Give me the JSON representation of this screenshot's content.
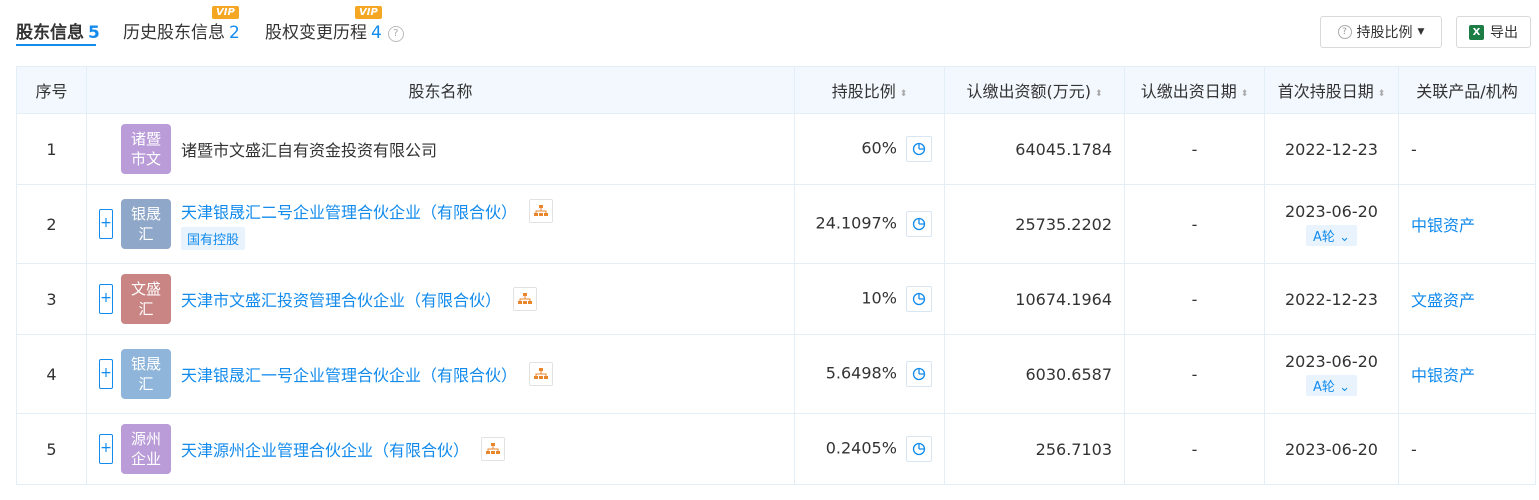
{
  "tabs": [
    {
      "label": "股东信息",
      "count": "5",
      "active": true
    },
    {
      "label": "历史股东信息",
      "count": "2",
      "vip": "VIP"
    },
    {
      "label": "股权变更历程",
      "count": "4",
      "vip": "VIP"
    }
  ],
  "toolbar": {
    "ratio_label": "持股比例",
    "export_label": "导出"
  },
  "columns": [
    "序号",
    "股东名称",
    "持股比例",
    "认缴出资额(万元)",
    "认缴出资日期",
    "首次持股日期",
    "关联产品/机构"
  ],
  "colors": {
    "accent": "#128bed"
  },
  "rows": [
    {
      "idx": "1",
      "logo": "诸暨市文",
      "logo_color": "#b99cd8",
      "name": "诸暨市文盛汇自有资金投资有限公司",
      "is_link": false,
      "tag": "",
      "ratio": "60%",
      "amount": "64045.1784",
      "date": "-",
      "first_date": "2022-12-23",
      "round": "",
      "product": "-"
    },
    {
      "idx": "2",
      "logo": "银晟汇",
      "logo_color": "#8fa7c8",
      "name": "天津银晟汇二号企业管理合伙企业（有限合伙）",
      "is_link": true,
      "tag": "国有控股",
      "ratio": "24.1097%",
      "amount": "25735.2202",
      "date": "-",
      "first_date": "2023-06-20",
      "round": "A轮",
      "product": "中银资产"
    },
    {
      "idx": "3",
      "logo": "文盛汇",
      "logo_color": "#c98484",
      "name": "天津市文盛汇投资管理合伙企业（有限合伙）",
      "is_link": true,
      "tag": "",
      "ratio": "10%",
      "amount": "10674.1964",
      "date": "-",
      "first_date": "2022-12-23",
      "round": "",
      "product": "文盛资产"
    },
    {
      "idx": "4",
      "logo": "银晟汇",
      "logo_color": "#8fb6da",
      "name": "天津银晟汇一号企业管理合伙企业（有限合伙）",
      "is_link": true,
      "tag": "",
      "ratio": "5.6498%",
      "amount": "6030.6587",
      "date": "-",
      "first_date": "2023-06-20",
      "round": "A轮",
      "product": "中银资产"
    },
    {
      "idx": "5",
      "logo": "源州企业",
      "logo_color": "#b99cd8",
      "name": "天津源州企业管理合伙企业（有限合伙）",
      "is_link": true,
      "tag": "",
      "ratio": "0.2405%",
      "amount": "256.7103",
      "date": "-",
      "first_date": "2023-06-20",
      "round": "",
      "product": "-"
    }
  ]
}
